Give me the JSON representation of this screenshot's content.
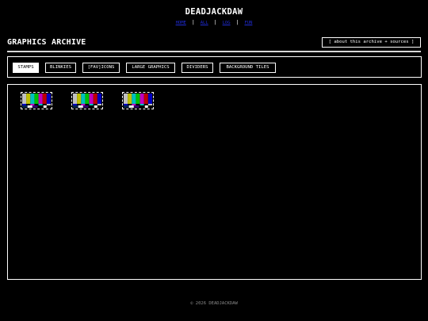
{
  "site": {
    "title": "DEADJACKDAW"
  },
  "nav": [
    {
      "label": "HOME"
    },
    {
      "label": "ALL"
    },
    {
      "label": "LOG"
    },
    {
      "label": "FUN"
    }
  ],
  "page": {
    "title": "GRAPHICS ARCHIVE"
  },
  "about_button": {
    "label": "[ about this archive + sources ]"
  },
  "tabs": [
    {
      "label": "STAMPS",
      "active": true
    },
    {
      "label": "BLINKIES",
      "active": false
    },
    {
      "label": "[FAV]ICONS",
      "active": false
    },
    {
      "label": "LARGE GRAPHICS",
      "active": false
    },
    {
      "label": "DIVIDERS",
      "active": false
    },
    {
      "label": "BACKGROUND TILES",
      "active": false
    }
  ],
  "stamps": [
    {
      "image": "color-bars-test-pattern"
    },
    {
      "image": "color-bars-test-pattern"
    },
    {
      "image": "color-bars-test-pattern"
    }
  ],
  "colors": {
    "background": "#000000",
    "text": "#ffffff",
    "nav_link": "#1f2bd6",
    "footer": "#8a8a8a",
    "test_bars": [
      "#c0c0c0",
      "#c0c000",
      "#00c0c0",
      "#00c000",
      "#c000c0",
      "#c00000",
      "#0000c0"
    ]
  },
  "footer": {
    "text": "© 2026 DEADJACKDAW"
  }
}
